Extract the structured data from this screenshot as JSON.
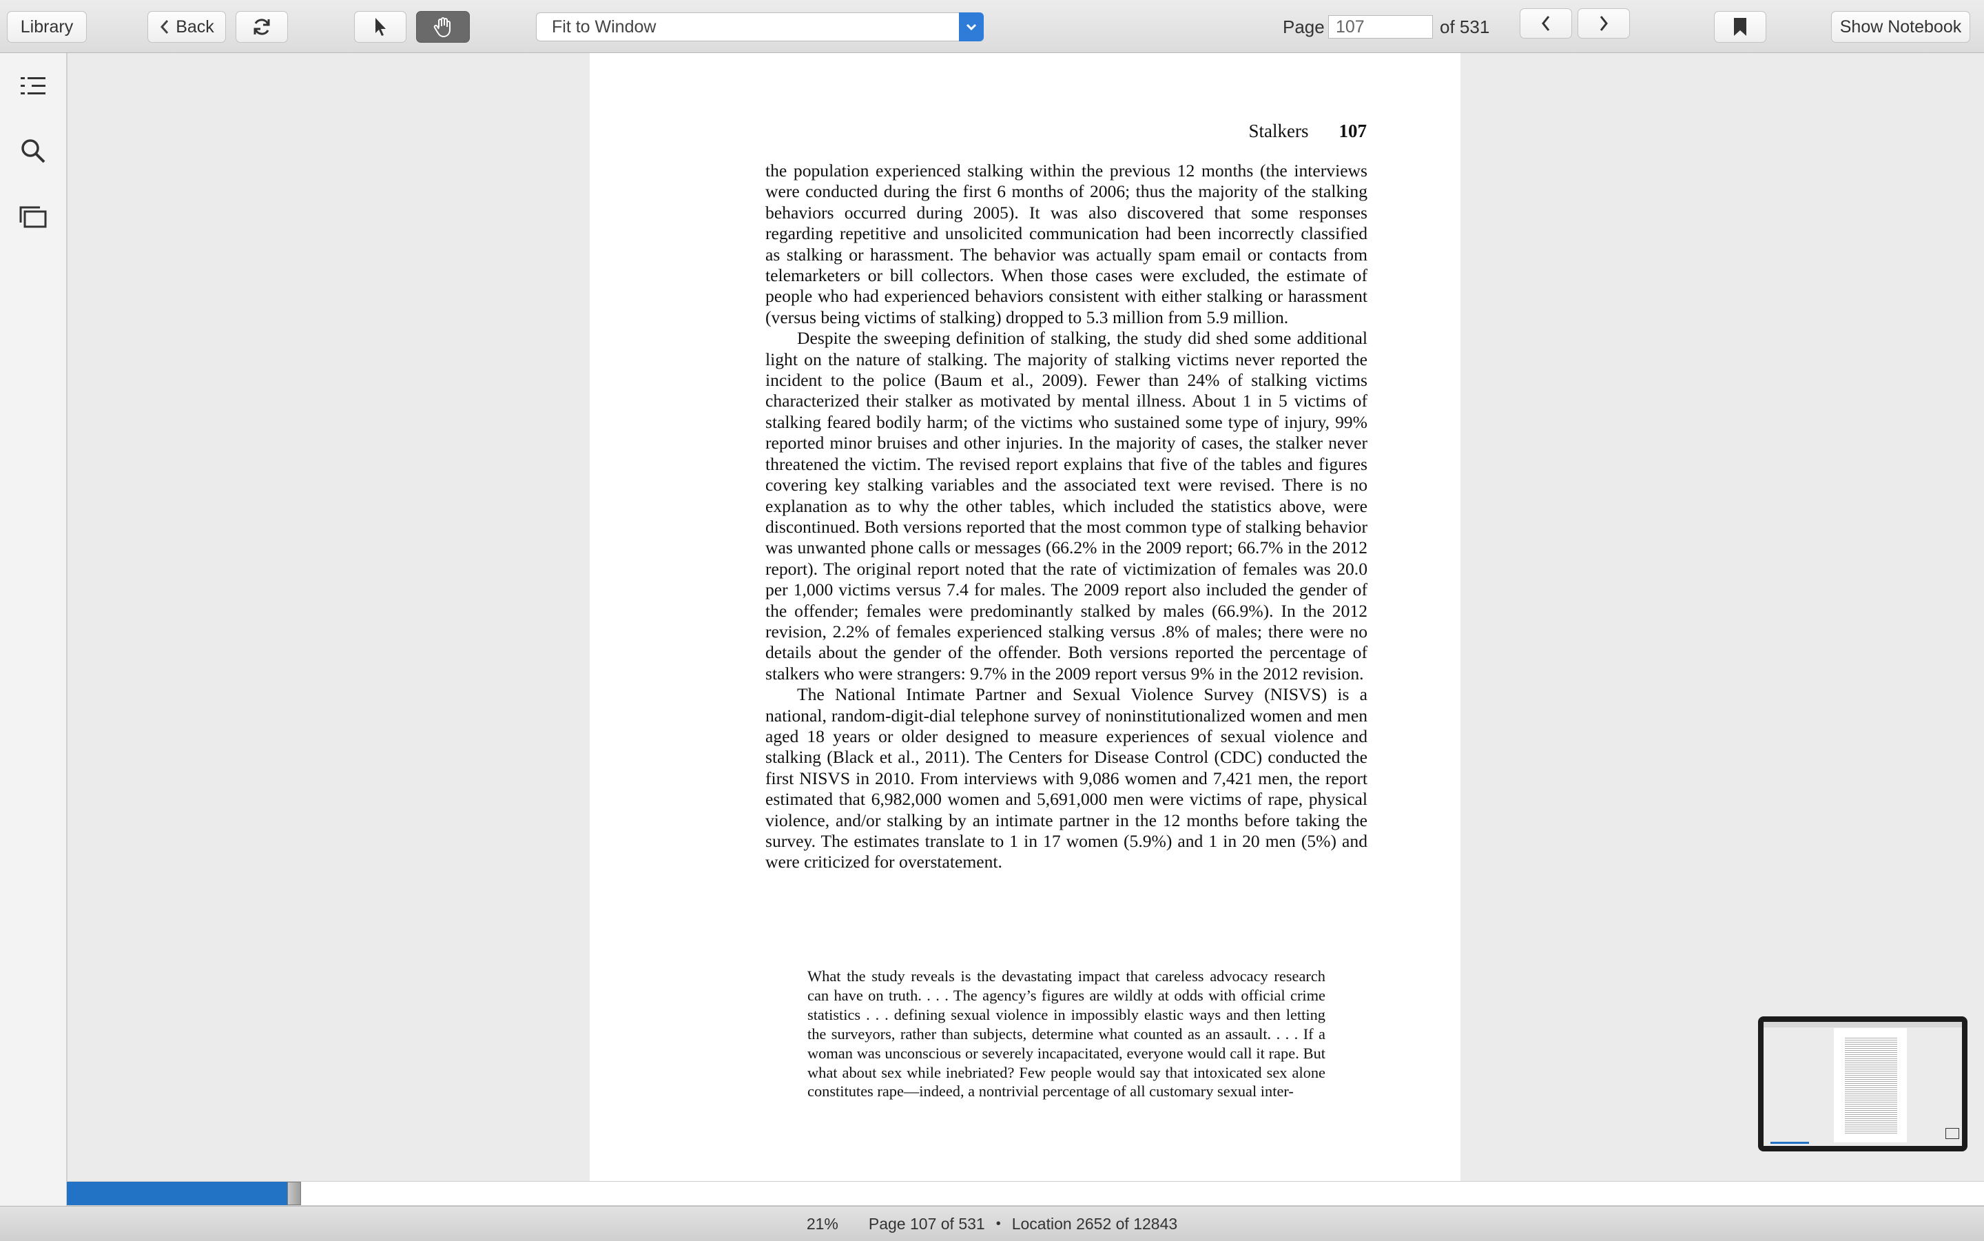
{
  "toolbar": {
    "library_label": "Library",
    "back_label": "Back",
    "fit_select_value": "Fit to Window",
    "page_label": "Page",
    "page_value": "107",
    "page_total": "of 531",
    "show_notebook_label": "Show Notebook",
    "icons": [
      "chevron-left-icon",
      "refresh-icon",
      "pointer-icon",
      "hand-icon",
      "chevron-down-icon",
      "prev-page-icon",
      "next-page-icon",
      "bookmark-icon"
    ]
  },
  "sidebar": {
    "icons": [
      "table-of-contents-icon",
      "search-icon",
      "thumbnails-icon"
    ]
  },
  "page": {
    "running_head_title": "Stalkers",
    "running_head_number": "107",
    "paragraphs": [
      "the population experienced stalking within the previous 12 months (the interviews were conducted during the first 6 months of 2006; thus the major­ity of the stalking behaviors occurred during 2005). It was also discovered that some responses regarding repetitive and unsolicited communication had been incorrectly classified as stalking or harassment. The behavior was actually spam email or contacts from telemarketers or bill collectors. When those cases were excluded, the estimate of people who had experienced behaviors consistent with either stalking or harassment (versus being vic­tims of stalking) dropped to 5.3 million from 5.9 million.",
      "Despite the sweeping definition of stalking, the study did shed some additional light on the nature of stalking. The majority of stalking victims never reported the incident to the police (Baum et al., 2009). Fewer than 24% of stalking victims characterized their stalker as motivated by mental illness. About 1 in 5 victims of stalking feared bodily harm; of the victims who sus­tained some type of injury, 99% reported minor bruises and other injuries. In the majority of cases, the stalker never threatened the victim. The revised report explains that five of the tables and figures covering key stalking vari­ables and the associated text were revised. There is no explanation as to why the other tables, which included the statistics above, were discontinued. Both versions reported that the most common type of stalking behavior was unwanted phone calls or messages (66.2% in the 2009 report; 66.7% in the 2012 report). The original report noted that the rate of victimization of females was 20.0 per 1,000 victims versus 7.4 for males. The 2009 report also included the gender of the offender; females were predominantly stalked by males (66.9%). In the 2012 revision, 2.2% of females experienced stalking versus .8% of males; there were no details about the gender of the offender. Both versions reported the percentage of stalkers who were strangers: 9.7% in the 2009 report versus 9% in the 2012 revision.",
      "The National Intimate Partner and Sexual Violence Survey (NISVS) is a national, random-digit-dial telephone survey of noninstitutionalized women and men aged 18 years or older designed to measure experiences of sexual violence and stalking (Black et al., 2011). The Centers for Disease Control (CDC) conducted the first NISVS in 2010. From interviews with 9,086 women and 7,421 men, the report estimated that 6,982,000 women and 5,691,000 men were victims of rape, physical violence, and/or stalking by an intimate partner in the 12 months before taking the survey. The estimates translate to 1 in 17 women (5.9%) and 1 in 20 men (5%) and were criticized for overstatement."
    ],
    "quote": "What the study reveals is the devastating impact that careless advocacy research can have on truth. . . . The agency’s figures are wildly at odds with official crime statistics . . . defining sexual violence in impossibly elastic ways and then letting the surveyors, rather than subjects, deter­mine what counted as an assault. . . . If a woman was unconscious or severely incapacitated, everyone would call it rape. But what about sex while inebriated? Few people would say that intoxicated sex alone consti­tutes rape—indeed, a nontrivial percentage of all customary sexual inter-"
  },
  "progress": {
    "fraction": 0.21
  },
  "status_bar": {
    "percent": "21%",
    "page_text": "Page 107 of 531",
    "location_text": "Location 2652 of 12843",
    "separator": "•"
  },
  "colors": {
    "accent": "#2273c6",
    "toolbar_bg": "#e4e4e4",
    "page_bg": "#ffffff"
  }
}
